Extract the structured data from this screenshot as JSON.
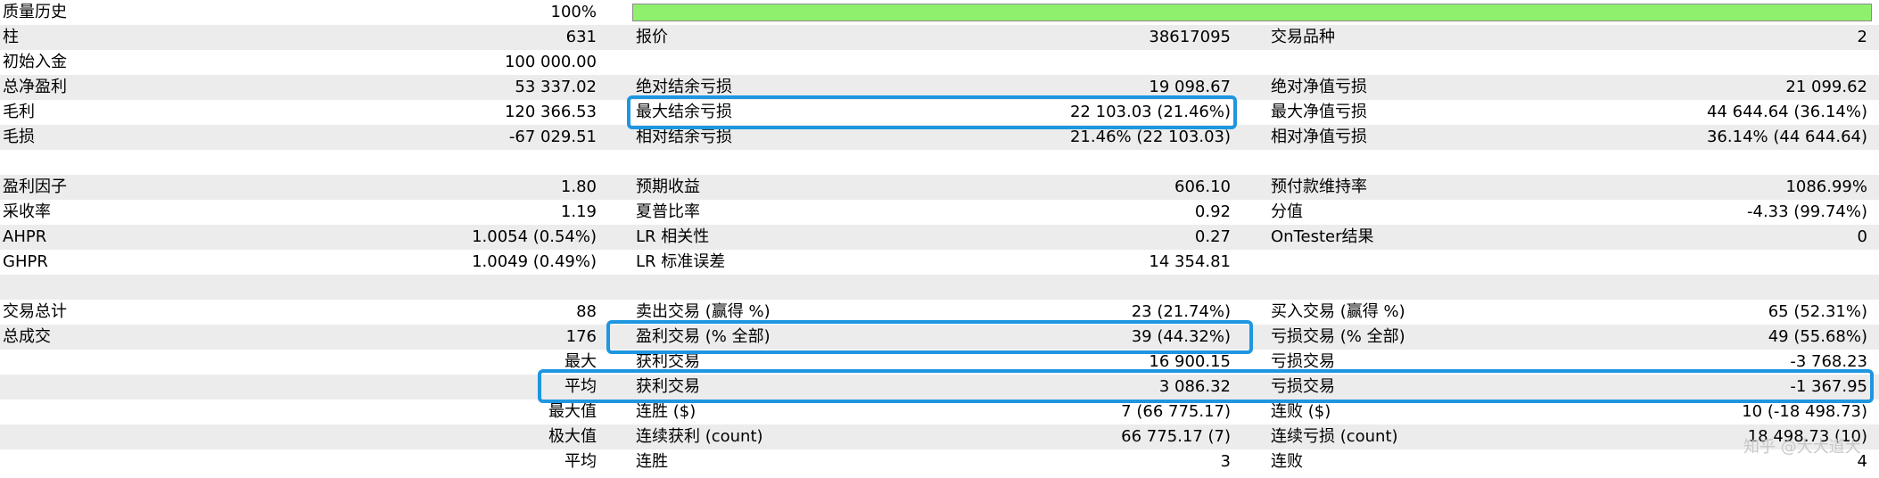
{
  "quality": {
    "label": "质量历史",
    "value": "100%",
    "progress": 1.0,
    "bar_color": "#8ef06c"
  },
  "rows": {
    "r2": {
      "c1l": "柱",
      "c1v": "631",
      "c2l": "报价",
      "c2v": "38617095",
      "c3l": "交易品种",
      "c3v": "2"
    },
    "r3": {
      "c1l": "初始入金",
      "c1v": "100 000.00"
    },
    "r4": {
      "c1l": "总净盈利",
      "c1v": "53 337.02",
      "c2l": "绝对结余亏损",
      "c2v": "19 098.67",
      "c3l": "绝对净值亏损",
      "c3v": "21 099.62"
    },
    "r5": {
      "c1l": "毛利",
      "c1v": "120 366.53",
      "c2l": "最大结余亏损",
      "c2v": "22 103.03 (21.46%)",
      "c3l": "最大净值亏损",
      "c3v": "44 644.64 (36.14%)"
    },
    "r6": {
      "c1l": "毛损",
      "c1v": "-67 029.51",
      "c2l": "相对结余亏损",
      "c2v": "21.46% (22 103.03)",
      "c3l": "相对净值亏损",
      "c3v": "36.14% (44 644.64)"
    },
    "r8": {
      "c1l": "盈利因子",
      "c1v": "1.80",
      "c2l": "预期收益",
      "c2v": "606.10",
      "c3l": "预付款维持率",
      "c3v": "1086.99%"
    },
    "r9": {
      "c1l": "采收率",
      "c1v": "1.19",
      "c2l": "夏普比率",
      "c2v": "0.92",
      "c3l": "分值",
      "c3v": "-4.33 (99.74%)"
    },
    "r10": {
      "c1l": "AHPR",
      "c1v": "1.0054 (0.54%)",
      "c2l": "LR 相关性",
      "c2v": "0.27",
      "c3l": "OnTester结果",
      "c3v": "0"
    },
    "r11": {
      "c1l": "GHPR",
      "c1v": "1.0049 (0.49%)",
      "c2l": "LR 标准误差",
      "c2v": "14 354.81"
    },
    "r13": {
      "c1l": "交易总计",
      "c1v": "88",
      "c2l": "卖出交易 (赢得 %)",
      "c2v": "23 (21.74%)",
      "c3l": "买入交易 (赢得 %)",
      "c3v": "65 (52.31%)"
    },
    "r14": {
      "c1l": "总成交",
      "c1v": "176",
      "c2l": "盈利交易 (% 全部)",
      "c2v": "39 (44.32%)",
      "c3l": "亏损交易 (% 全部)",
      "c3v": "49 (55.68%)"
    },
    "r15": {
      "sub": "最大",
      "c2l": "获利交易",
      "c2v": "16 900.15",
      "c3l": "亏损交易",
      "c3v": "-3 768.23"
    },
    "r16": {
      "sub": "平均",
      "c2l": "获利交易",
      "c2v": "3 086.32",
      "c3l": "亏损交易",
      "c3v": "-1 367.95"
    },
    "r17": {
      "sub": "最大值",
      "c2l": "连胜 ($)",
      "c2v": "7 (66 775.17)",
      "c3l": "连败 ($)",
      "c3v": "10 (-18 498.73)"
    },
    "r18": {
      "sub": "极大值",
      "c2l": "连续获利 (count)",
      "c2v": "66 775.17 (7)",
      "c3l": "连续亏损 (count)",
      "c3v": "18 498.73 (10)"
    },
    "r19": {
      "sub": "平均",
      "c2l": "连胜",
      "c2v": "3",
      "c3l": "连败",
      "c3v": "4"
    }
  },
  "highlight_color": "#1e96e0",
  "watermark": "知乎 @大大道大"
}
